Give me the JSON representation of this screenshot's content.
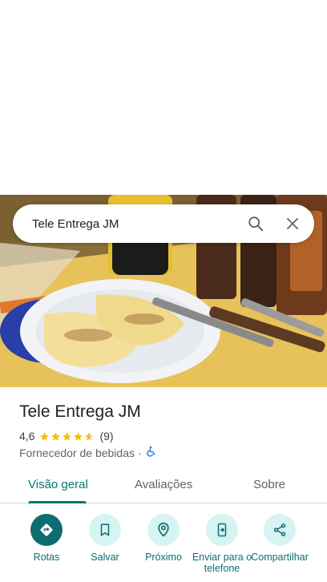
{
  "search": {
    "query": "Tele Entrega JM",
    "search_icon": "search-icon",
    "close_icon": "close-icon"
  },
  "hero": {
    "image": "photo-of-food-plate"
  },
  "place": {
    "name": "Tele Entrega JM",
    "rating": "4,6",
    "rating_value": 4.6,
    "reviews_count": "(9)",
    "category": "Fornecedor de bebidas",
    "separator": "·",
    "accessibility_icon": "wheelchair-icon"
  },
  "tabs": [
    {
      "label": "Visão geral",
      "active": true
    },
    {
      "label": "Avaliações",
      "active": false
    },
    {
      "label": "Sobre",
      "active": false
    }
  ],
  "actions": [
    {
      "label": "Rotas",
      "icon": "directions-icon"
    },
    {
      "label": "Salvar",
      "icon": "bookmark-icon"
    },
    {
      "label": "Próximo",
      "icon": "nearby-icon"
    },
    {
      "label": "Enviar para o telefone",
      "icon": "send-to-phone-icon"
    },
    {
      "label": "Compartilhar",
      "icon": "share-icon"
    }
  ],
  "colors": {
    "accent": "#00796b",
    "action_bg": "#d6f4f2",
    "primary_action": "#0e6d70",
    "star": "#fbbc04"
  }
}
